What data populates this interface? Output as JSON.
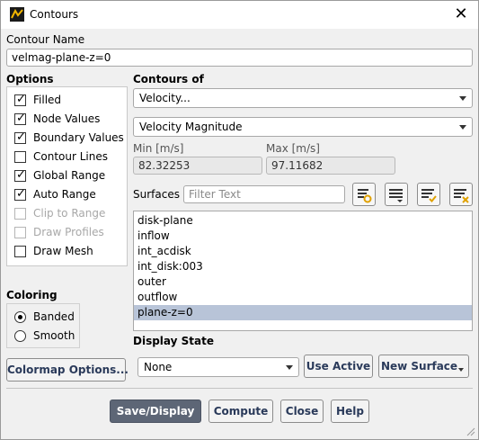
{
  "window": {
    "title": "Contours"
  },
  "contour_name": {
    "label": "Contour Name",
    "value": "velmag-plane-z=0"
  },
  "options": {
    "label": "Options",
    "items": [
      {
        "label": "Filled",
        "checked": true,
        "disabled": false
      },
      {
        "label": "Node Values",
        "checked": true,
        "disabled": false
      },
      {
        "label": "Boundary Values",
        "checked": true,
        "disabled": false
      },
      {
        "label": "Contour Lines",
        "checked": false,
        "disabled": false
      },
      {
        "label": "Global Range",
        "checked": true,
        "disabled": false
      },
      {
        "label": "Auto Range",
        "checked": true,
        "disabled": false
      },
      {
        "label": "Clip to Range",
        "checked": false,
        "disabled": true
      },
      {
        "label": "Draw Profiles",
        "checked": false,
        "disabled": true
      },
      {
        "label": "Draw Mesh",
        "checked": false,
        "disabled": false
      }
    ]
  },
  "contours_of": {
    "label": "Contours of",
    "category": "Velocity...",
    "variable": "Velocity Magnitude"
  },
  "range": {
    "min_label": "Min [m/s]",
    "min_value": "82.32253",
    "max_label": "Max [m/s]",
    "max_value": "97.11682"
  },
  "surfaces": {
    "label": "Surfaces",
    "filter_placeholder": "Filter Text",
    "items": [
      {
        "label": "disk-plane",
        "selected": false
      },
      {
        "label": "inflow",
        "selected": false
      },
      {
        "label": "int_acdisk",
        "selected": false
      },
      {
        "label": "int_disk:003",
        "selected": false
      },
      {
        "label": "outer",
        "selected": false
      },
      {
        "label": "outflow",
        "selected": false
      },
      {
        "label": "plane-z=0",
        "selected": true
      }
    ]
  },
  "coloring": {
    "label": "Coloring",
    "options": [
      {
        "label": "Banded",
        "selected": true
      },
      {
        "label": "Smooth",
        "selected": false
      }
    ],
    "colormap_button": "Colormap Options..."
  },
  "display_state": {
    "label": "Display State",
    "value": "None",
    "use_active": "Use Active",
    "new_surface": "New Surface"
  },
  "footer": {
    "save_display": "Save/Display",
    "compute": "Compute",
    "close": "Close",
    "help": "Help"
  },
  "colors": {
    "selection": "#b8c4d8",
    "primary_button": "#5d6676",
    "accent_icon": "#e0a100"
  }
}
